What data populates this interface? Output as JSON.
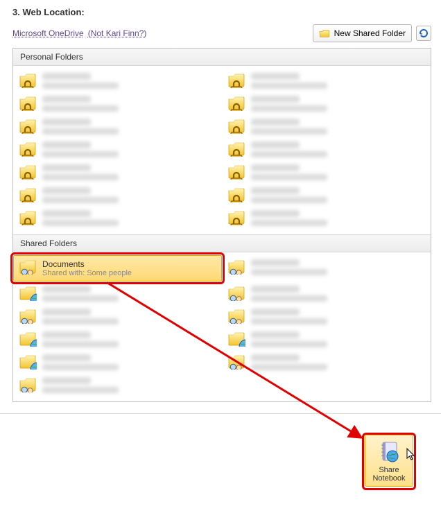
{
  "heading": "3. Web Location:",
  "breadcrumb": {
    "service": "Microsoft OneDrive",
    "not_user": "(Not Kari Finn?)"
  },
  "buttons": {
    "new_shared_folder": "New Shared Folder",
    "refresh_title": "Refresh"
  },
  "sections": {
    "personal": "Personal Folders",
    "shared": "Shared Folders"
  },
  "selected_folder": {
    "name": "Documents",
    "subtitle": "Shared with: Some people"
  },
  "share_button": {
    "line1": "Share",
    "line2": "Notebook"
  },
  "personal_folders": [
    {
      "name": "",
      "sub": ""
    },
    {
      "name": "",
      "sub": ""
    },
    {
      "name": "",
      "sub": ""
    },
    {
      "name": "",
      "sub": ""
    },
    {
      "name": "",
      "sub": ""
    },
    {
      "name": "",
      "sub": ""
    },
    {
      "name": "",
      "sub": ""
    },
    {
      "name": "",
      "sub": ""
    },
    {
      "name": "",
      "sub": ""
    },
    {
      "name": "",
      "sub": ""
    },
    {
      "name": "",
      "sub": ""
    },
    {
      "name": "",
      "sub": ""
    },
    {
      "name": "",
      "sub": ""
    },
    {
      "name": "",
      "sub": ""
    }
  ],
  "shared_folders": [
    {
      "name": "Documents",
      "sub": "Shared with: Some people",
      "selected": true,
      "ov": "people"
    },
    {
      "name": "",
      "sub": "",
      "ov": "people"
    },
    {
      "name": "",
      "sub": "",
      "ov": "globe"
    },
    {
      "name": "",
      "sub": "",
      "ov": "people"
    },
    {
      "name": "",
      "sub": "",
      "ov": "people"
    },
    {
      "name": "",
      "sub": "",
      "ov": "people"
    },
    {
      "name": "",
      "sub": "",
      "ov": "globe"
    },
    {
      "name": "",
      "sub": "",
      "ov": "globe"
    },
    {
      "name": "",
      "sub": "",
      "ov": "globe"
    },
    {
      "name": "",
      "sub": "",
      "ov": "people"
    },
    {
      "name": "",
      "sub": "",
      "ov": "people"
    }
  ]
}
